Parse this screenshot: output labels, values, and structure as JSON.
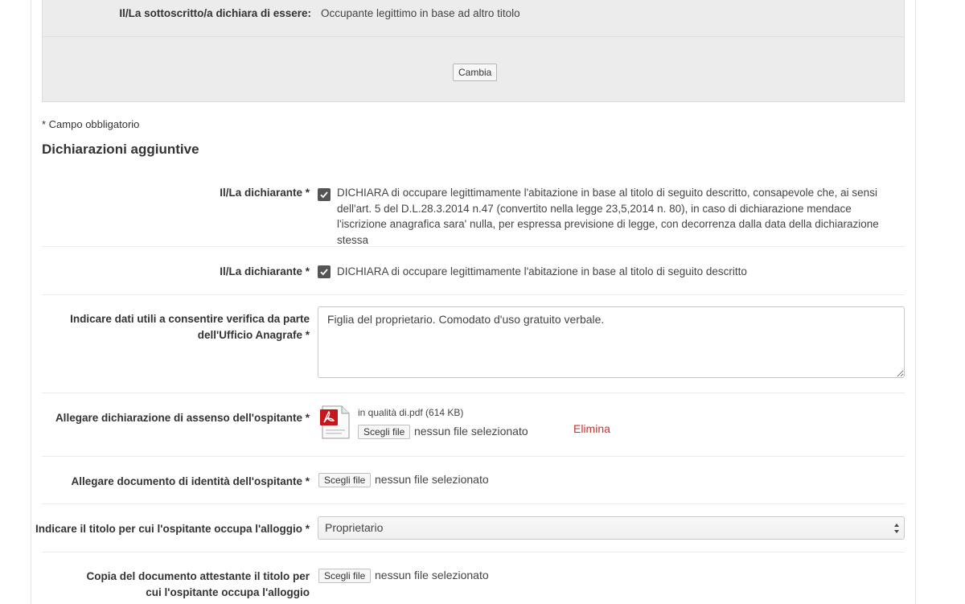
{
  "summary": {
    "label": "Il/La sottoscritto/a dichiara di essere:",
    "value": "Occupante legittimo in base ad altro titolo",
    "change_button": "Cambia"
  },
  "required_note": "* Campo obbligatorio",
  "section_title": "Dichiarazioni aggiuntive",
  "declarations": [
    {
      "label": "Il/La dichiarante *",
      "checked": true,
      "text": "DICHIARA di occupare legittimamente l'abitazione in base al titolo di seguito descritto, consapevole che, ai sensi dell'art. 5 del D.L.28.3.2014 n.47 (convertito nella legge 23,5,2014 n. 80), in caso di dichiarazione mendace l'iscrizione anagrafica sara' nulla, per espressa previsione di legge, con decorrenza dalla data della dichiarazione stessa"
    },
    {
      "label": "Il/La dichiarante *",
      "checked": true,
      "text": "DICHIARA di occupare legittimamente l'abitazione in base al titolo di seguito descritto"
    }
  ],
  "verification": {
    "label": "Indicare dati utili a consentire verifica da parte dell'Ufficio Anagrafe *",
    "value": "Figlia del proprietario. Comodato d'uso gratuito verbale."
  },
  "consent_attachment": {
    "label": "Allegare dichiarazione di assenso dell'ospitante *",
    "file_name": "in qualità di.pdf (614 KB)",
    "choose_label": "Scegli file",
    "status": "nessun file selezionato",
    "delete_label": "Elimina"
  },
  "identity_attachment": {
    "label": "Allegare documento di identità dell'ospitante *",
    "choose_label": "Scegli file",
    "status": "nessun file selezionato"
  },
  "title_select": {
    "label": "Indicare il titolo per cui l'ospitante occupa l'alloggio *",
    "selected": "Proprietario"
  },
  "title_document": {
    "label": "Copia del documento attestante il titolo per cui l'ospitante occupa l'alloggio",
    "choose_label": "Scegli file",
    "status": "nessun file selezionato"
  },
  "colors": {
    "panel_bg": "#ececec",
    "checkbox": "#555555",
    "delete_link": "#c9302c",
    "pdf_red": "#c4161c"
  },
  "icons": {
    "checkbox": "check-icon",
    "pdf": "pdf-file-icon",
    "select": "select-arrows-icon"
  }
}
